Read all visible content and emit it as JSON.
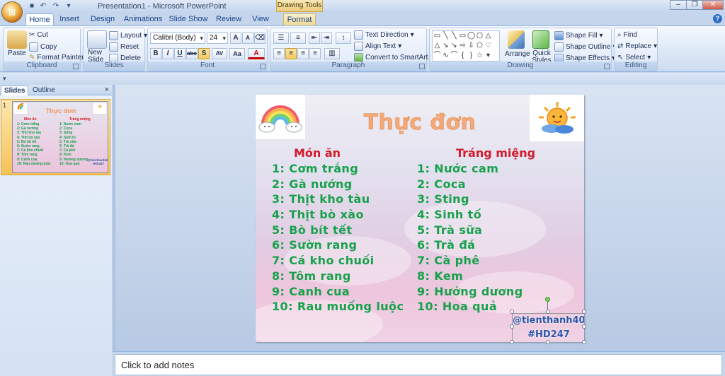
{
  "window": {
    "title": "Presentation1 - Microsoft PowerPoint",
    "contextual_tab_group": "Drawing Tools"
  },
  "tabs": [
    {
      "label": "Home",
      "active": true
    },
    {
      "label": "Insert"
    },
    {
      "label": "Design"
    },
    {
      "label": "Animations"
    },
    {
      "label": "Slide Show"
    },
    {
      "label": "Review"
    },
    {
      "label": "View"
    },
    {
      "label": "Format",
      "contextual": true
    }
  ],
  "ribbon": {
    "clipboard": {
      "label": "Clipboard",
      "paste": "Paste",
      "cut": "Cut",
      "copy": "Copy",
      "format_painter": "Format Painter"
    },
    "slides": {
      "label": "Slides",
      "new_slide": "New Slide",
      "layout": "Layout",
      "reset": "Reset",
      "delete": "Delete"
    },
    "font": {
      "label": "Font",
      "font_name": "Calibri (Body)",
      "font_size": "24",
      "bold": "B",
      "italic": "I",
      "underline": "U",
      "strike": "abc",
      "shadow": "S",
      "spacing": "AV",
      "case": "Aa"
    },
    "paragraph": {
      "label": "Paragraph",
      "text_direction": "Text Direction",
      "align_text": "Align Text",
      "convert_smartart": "Convert to SmartArt"
    },
    "drawing": {
      "label": "Drawing",
      "arrange": "Arrange",
      "quick_styles": "Quick Styles",
      "shape_fill": "Shape Fill",
      "shape_outline": "Shape Outline",
      "shape_effects": "Shape Effects"
    },
    "editing": {
      "label": "Editing",
      "find": "Find",
      "replace": "Replace",
      "select": "Select"
    }
  },
  "slides_pane": {
    "tab_slides": "Slides",
    "tab_outline": "Outline",
    "slide_number": "1"
  },
  "slide": {
    "title": "Thực đơn",
    "left_heading": "Món ăn",
    "right_heading": "Tráng miệng",
    "left_items": [
      "1: Cơm trắng",
      "2: Gà nướng",
      "3: Thịt kho tàu",
      "4: Thịt bò xào",
      "5: Bò bít tết",
      "6: Sườn rang",
      "7: Cá kho chuối",
      "8: Tôm rang",
      "9: Canh cua",
      "10: Rau muống luộc"
    ],
    "right_items": [
      "1: Nước cam",
      "2: Coca",
      "3: Sting",
      "4: Sinh tố",
      "5: Trà sữa",
      "6: Trà đá",
      "7: Cà phê",
      "8: Kem",
      "9: Hướng dương",
      "10: Hoa quả"
    ],
    "credit_line1": "@tienthanh40",
    "credit_line2": "#HD247"
  },
  "notes": {
    "placeholder": "Click to add notes"
  },
  "colors": {
    "title": "#f4a97a",
    "heading": "#d11a2a",
    "items": "#17a14b",
    "credit": "#2b56a8"
  }
}
